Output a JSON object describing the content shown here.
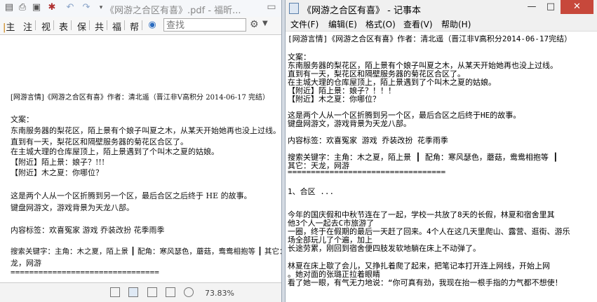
{
  "pdf": {
    "title": "《网游之合区有喜》.pdf - 福昕...",
    "tabs": [
      "主",
      "注",
      "视",
      "表",
      "保",
      "共",
      "福",
      "帮"
    ],
    "search_placeholder": "查找",
    "lines": [
      "[网游言情]《网游之合区有喜》作者：清北遥（晋江非V高积分 2014-06-17 完结）",
      "文案：",
      "东南服务器的梨花区，陌上景有个娘子叫夏之木，从某天开始她再也没上过线。",
      "直到有一天，梨花区和隔壁服务器的菊花区合区了。",
      "在主城大理的仓库屋顶上，陌上景遇到了个叫木之夏的姑娘。",
      "【附近】陌上景：娘子？!!!",
      "【附近】木之夏：你哪位？",
      "这是两个人从一个区折腾到另一个区，最后合区之后终于 HE 的故事。",
      "键盘网游文，游戏背景为天龙八部。",
      "内容标签：欢喜冤家  游戏  乔装改扮  花季雨季",
      "搜索关键字：主角：木之夏，陌上景  ┃  配角：寒风瑟色，蘑菇，鸯鸯相抱等  ┃  其它：天",
      "龙，网游",
      "================================"
    ],
    "zoom": "73.83%"
  },
  "notepad": {
    "title": "《网游之合区有喜》 - 记事本",
    "menu": [
      "文件(F)",
      "编辑(E)",
      "格式(O)",
      "查看(V)",
      "帮助(H)"
    ],
    "lines": [
      "[网游言情]《网游之合区有喜》作者：清北遥（晋江非V高积分2014-06-17完结）",
      "文案：",
      "东南服务器的梨花区，陌上景有个娘子叫夏之木，从某天开始她再也没上过线。",
      "直到有一天，梨花区和隔壁服务器的菊花区合区了。",
      "在主城大理的仓库屋顶上，陌上景遇到了个叫木之夏的姑娘。",
      "【附近】陌上景：娘子？！！！",
      "【附近】木之夏：你哪位？",
      "这是两个人从一个区折腾到另一个区，最后合区之后终于HE的故事。",
      "键盘网游文，游戏背景为天龙八部。",
      "内容标签：欢喜冤家 游戏 乔装改扮 花季雨季",
      "搜索关键字：主角：木之夏，陌上景 ┃ 配角：寒风瑟色，蘑菇，鸯鸯相抱等 ┃",
      "其它：天龙，网游",
      "==================================",
      "1、合区 ...",
      "     今年的国庆假和中秋节连在了一起，学校一共放了8天的长假，林夏和宿舍里其",
      "他3个人一起去C市旅游了",
      "一圈，终于在假期的最后一天赶了回来。4个人在这几天里爬山、露营、逛街、游乐",
      "场全部玩儿了个遍，加上",
      "长途劳累，刚回到宿舍便四肢发软地躺在床上不动弹了。",
      "     林夏在床上歇了会儿，又挣扎着爬了起来，把笔记本打开连上网线，开始上网",
      "。她对面的张璐正拉着眼睛",
      "看了她一眼，有气无力地说：“你可真有劲，我现在抬一根手指的力气都不想使！"
    ]
  }
}
